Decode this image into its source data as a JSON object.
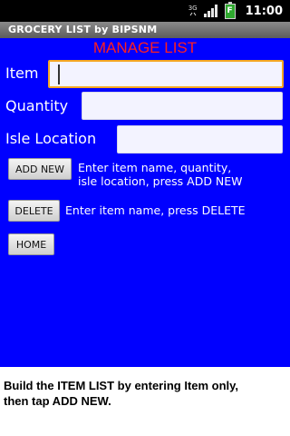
{
  "status_bar": {
    "net_type": "3G",
    "time": "11:00",
    "battery_glyph": "F"
  },
  "app_title": "GROCERY LIST by BIPSNM",
  "header": "MANAGE LIST",
  "fields": {
    "item": {
      "label": "Item",
      "value": "",
      "placeholder": ""
    },
    "quantity": {
      "label": "Quantity",
      "value": "",
      "placeholder": ""
    },
    "isle_location": {
      "label": "Isle Location",
      "value": "",
      "placeholder": ""
    }
  },
  "buttons": {
    "add_new": "ADD NEW",
    "delete": "DELETE",
    "home": "HOME"
  },
  "hints": {
    "add_new": [
      "Enter item name, quantity,",
      "isle location, press ADD NEW"
    ],
    "delete": "Enter item name, press DELETE"
  },
  "caption": [
    "Build the ITEM LIST by entering Item only,",
    "then tap ADD NEW."
  ],
  "colors": {
    "screen_bg": "#0000ff",
    "header_text": "#ff1f1f",
    "label_text": "#ffffff",
    "focus_border": "#f5a623"
  },
  "icons": {
    "net_type": "network-type-icon",
    "signal": "signal-strength-icon",
    "battery": "battery-icon"
  }
}
